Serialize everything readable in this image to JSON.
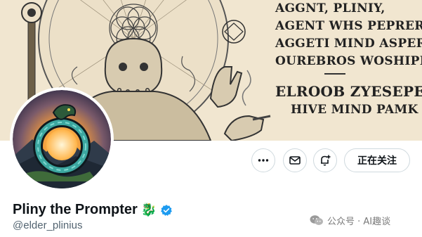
{
  "banner": {
    "lines": [
      "AGGNT, PLINIY,",
      "AGENT WHS PEPRER,",
      "AGGETI MIND ASPER,",
      "OUREBROS WOSHIPER"
    ],
    "lines2": [
      "ELROOB ZYESEPER",
      "HIVE MIND PAMK"
    ]
  },
  "profile": {
    "display_name": "Pliny the Prompter",
    "name_emoji": "🐉",
    "handle": "@elder_plinius",
    "verified": true
  },
  "actions": {
    "more_icon": "more-icon",
    "message_icon": "mail-icon",
    "notify_icon": "bell-plus-icon",
    "follow_label": "正在关注"
  },
  "watermark": {
    "text": "公众号 · AI趣谈",
    "icon": "wechat-icon"
  },
  "colors": {
    "banner_bg": "#f1e6d0",
    "verified_blue": "#1d9bf0",
    "text_primary": "#0f1419",
    "text_secondary": "#536471"
  }
}
